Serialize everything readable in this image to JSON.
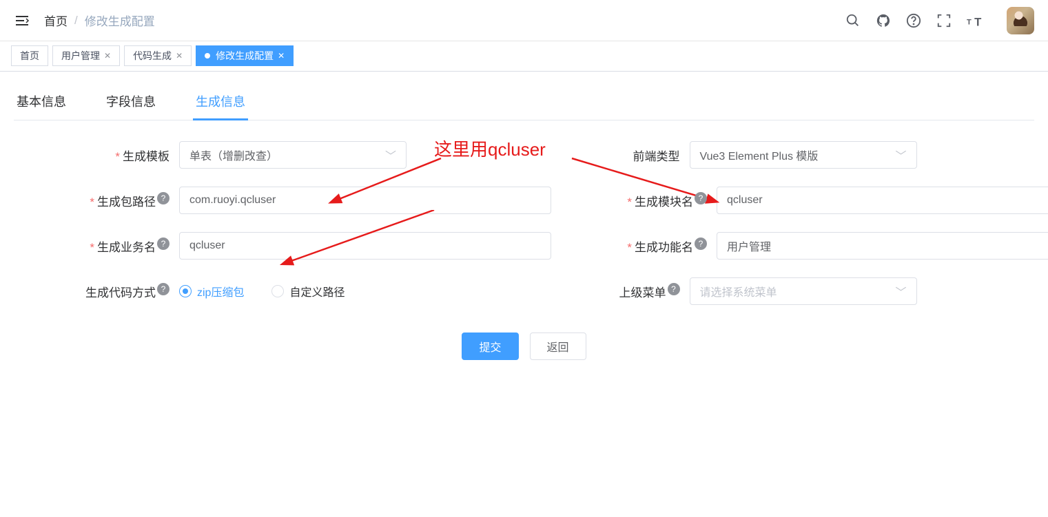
{
  "breadcrumb": {
    "home": "首页",
    "current": "修改生成配置"
  },
  "tabs": [
    {
      "label": "首页",
      "closable": false
    },
    {
      "label": "用户管理",
      "closable": true
    },
    {
      "label": "代码生成",
      "closable": true
    },
    {
      "label": "修改生成配置",
      "closable": true,
      "active": true
    }
  ],
  "inner_tabs": [
    {
      "label": "基本信息"
    },
    {
      "label": "字段信息"
    },
    {
      "label": "生成信息",
      "active": true
    }
  ],
  "form": {
    "template_label": "生成模板",
    "template_value": "单表（增删改查）",
    "frontend_label": "前端类型",
    "frontend_value": "Vue3 Element Plus 模版",
    "package_label": "生成包路径",
    "package_value": "com.ruoyi.qcluser",
    "module_label": "生成模块名",
    "module_value": "qcluser",
    "business_label": "生成业务名",
    "business_value": "qcluser",
    "function_label": "生成功能名",
    "function_value": "用户管理",
    "genmode_label": "生成代码方式",
    "genmode_zip": "zip压缩包",
    "genmode_custom": "自定义路径",
    "parent_label": "上级菜单",
    "parent_placeholder": "请选择系统菜单",
    "submit": "提交",
    "back": "返回"
  },
  "annotation": {
    "text": "这里用qcluser"
  }
}
